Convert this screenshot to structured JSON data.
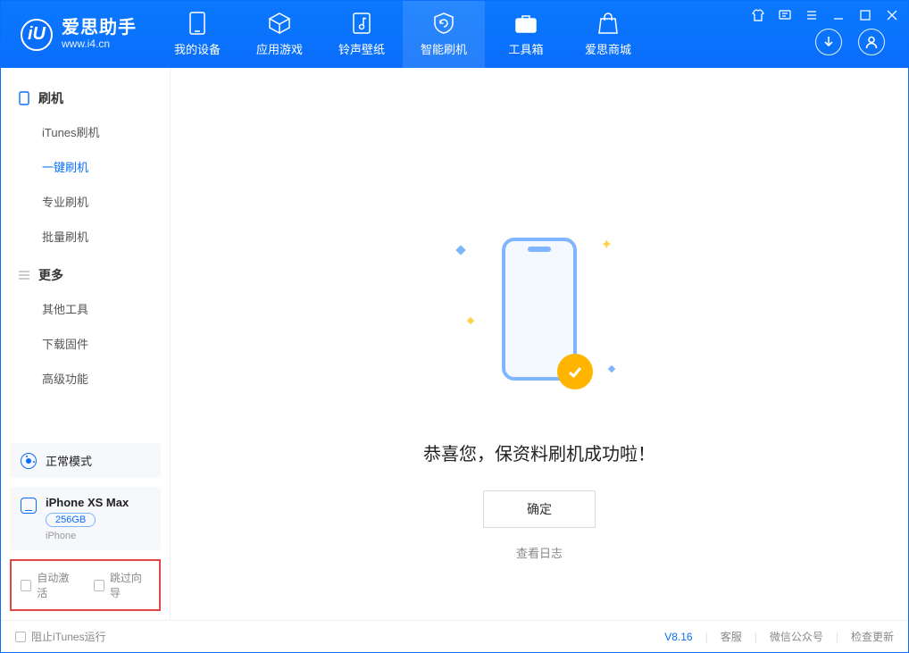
{
  "app": {
    "name": "爱思助手",
    "site": "www.i4.cn",
    "logo_letter": "iU"
  },
  "tabs": {
    "device": "我的设备",
    "apps": "应用游戏",
    "ringtone": "铃声壁纸",
    "flash": "智能刷机",
    "toolbox": "工具箱",
    "store": "爱思商城"
  },
  "sidebar": {
    "section_flash": "刷机",
    "items_flash": {
      "itunes": "iTunes刷机",
      "oneclick": "一键刷机",
      "pro": "专业刷机",
      "batch": "批量刷机"
    },
    "section_more": "更多",
    "items_more": {
      "other_tools": "其他工具",
      "download_fw": "下载固件",
      "advanced": "高级功能"
    }
  },
  "mode_card": {
    "label": "正常模式"
  },
  "device_card": {
    "name": "iPhone XS Max",
    "capacity": "256GB",
    "type": "iPhone"
  },
  "options": {
    "auto_activate": "自动激活",
    "skip_guide": "跳过向导"
  },
  "main": {
    "success_text": "恭喜您，保资料刷机成功啦！",
    "ok_btn": "确定",
    "view_log": "查看日志"
  },
  "statusbar": {
    "block_itunes": "阻止iTunes运行",
    "version": "V8.16",
    "support": "客服",
    "wechat": "微信公众号",
    "update": "检查更新"
  }
}
